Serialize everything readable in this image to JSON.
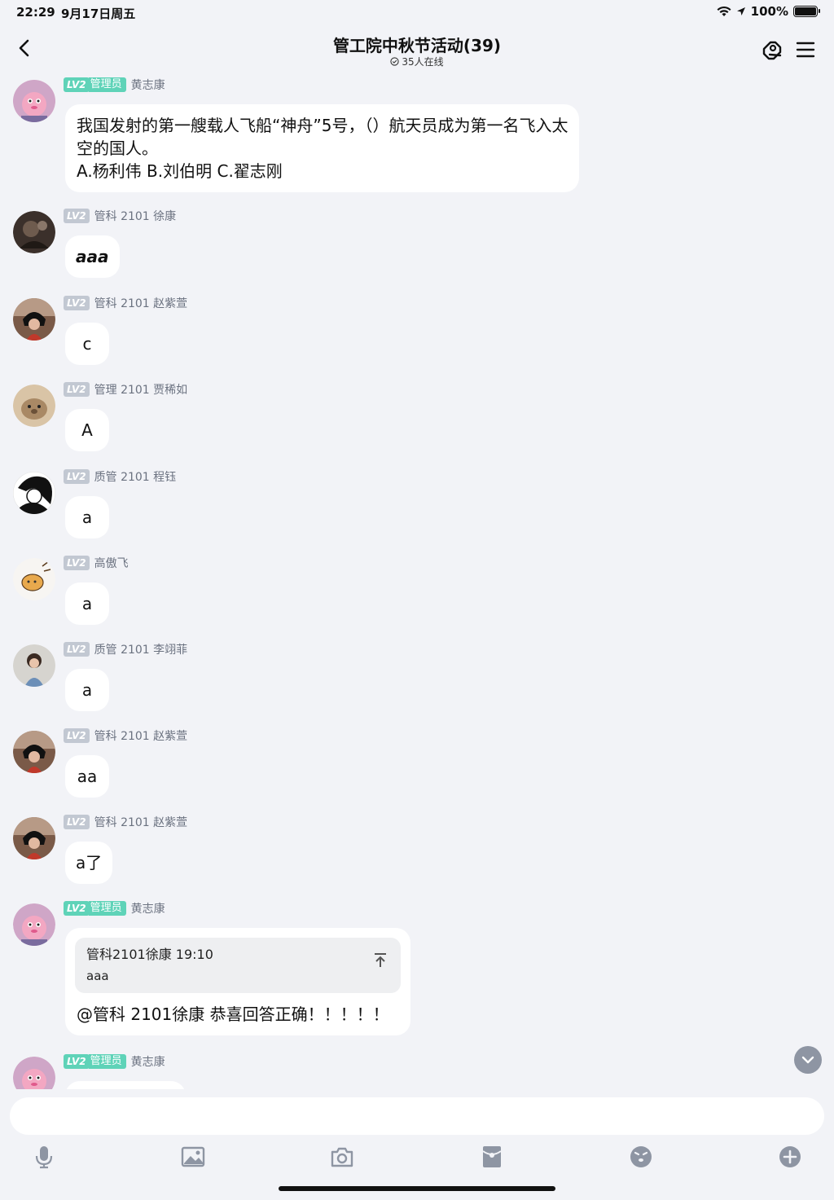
{
  "status_bar": {
    "time": "22:29",
    "date": "9月17日周五",
    "battery": "100%",
    "battery_level": 1.0
  },
  "header": {
    "title": "管工院中秋节活动(39)",
    "online": "35人在线"
  },
  "messages": [
    {
      "level": "LV2",
      "role": "管理员",
      "sender": "黄志康",
      "lines": [
        "我国发射的第一艘载人飞船“神舟”5号，（）航天员成为第一名飞入太",
        "空的国人。",
        "A.杨利伟 B.刘伯明 C.翟志刚"
      ]
    },
    {
      "level": "LV2",
      "sender": "管科 2101 徐康",
      "text": "aaa"
    },
    {
      "level": "LV2",
      "sender": "管科 2101 赵紫萱",
      "text": "c"
    },
    {
      "level": "LV2",
      "sender": "管理 2101 贾稀如",
      "text": "A"
    },
    {
      "level": "LV2",
      "sender": "质管 2101 程钰",
      "text": "a"
    },
    {
      "level": "LV2",
      "sender": "高傲飞",
      "text": "a"
    },
    {
      "level": "LV2",
      "sender": "质管 2101 李翊菲",
      "text": "a"
    },
    {
      "level": "LV2",
      "sender": "管科 2101 赵紫萱",
      "text": "aa"
    },
    {
      "level": "LV2",
      "sender": "管科 2101 赵紫萱",
      "text": "a了"
    },
    {
      "level": "LV2",
      "role": "管理员",
      "sender": "黄志康",
      "quote": {
        "header": "管科2101徐康 19:10",
        "body": "aaa"
      },
      "text": "@管科 2101徐康 恭喜回答正确！！！！！"
    },
    {
      "level": "LV2",
      "role": "管理员",
      "sender": "黄志康",
      "text": ""
    }
  ],
  "composer": {
    "placeholder": ""
  },
  "toolbar_icons": [
    "microphone-icon",
    "image-icon",
    "camera-icon",
    "red-packet-icon",
    "emoji-icon",
    "plus-icon"
  ],
  "colors": {
    "background": "#f2f3f7",
    "admin_badge": "#5fd3b8",
    "level_badge": "#c2c8d2",
    "bubble": "#ffffff"
  }
}
